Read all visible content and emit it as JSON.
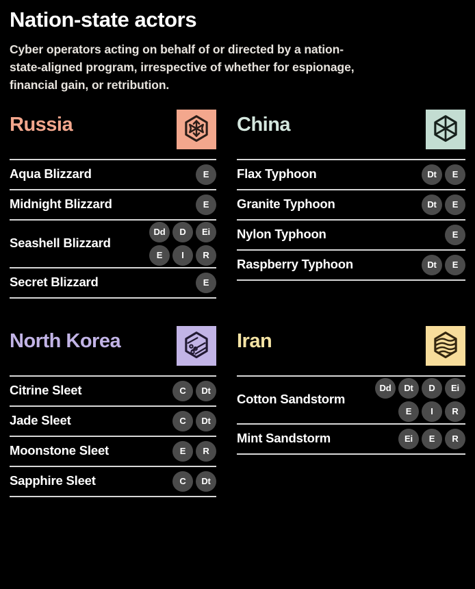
{
  "header": {
    "title": "Nation-state actors",
    "subtitle": "Cyber operators acting on behalf of or directed by a nation-state-aligned program, irrespective of whether for espionage, financial gain, or retribution."
  },
  "panels": [
    {
      "country": "Russia",
      "name_color": "#f3a78d",
      "badge_bg": "#f3a78d",
      "badge_fg": "#2b1d18",
      "icon": "blizzard-hexagon-icon",
      "actors": [
        {
          "name": "Aqua Blizzard",
          "tags": [
            "E"
          ]
        },
        {
          "name": "Midnight Blizzard",
          "tags": [
            "E"
          ]
        },
        {
          "name": "Seashell Blizzard",
          "tags": [
            "Dd",
            "D",
            "Ei",
            "E",
            "I",
            "R"
          ]
        },
        {
          "name": "Secret Blizzard",
          "tags": [
            "E"
          ]
        }
      ]
    },
    {
      "country": "China",
      "name_color": "#d4e7de",
      "badge_bg": "#c3ddd2",
      "badge_fg": "#17211c",
      "icon": "typhoon-hexagon-icon",
      "actors": [
        {
          "name": "Flax Typhoon",
          "tags": [
            "Dt",
            "E"
          ]
        },
        {
          "name": "Granite Typhoon",
          "tags": [
            "Dt",
            "E"
          ]
        },
        {
          "name": "Nylon Typhoon",
          "tags": [
            "E"
          ]
        },
        {
          "name": "Raspberry Typhoon",
          "tags": [
            "Dt",
            "E"
          ]
        }
      ]
    },
    {
      "country": "North Korea",
      "name_color": "#c2b4e6",
      "badge_bg": "#c2b4e6",
      "badge_fg": "#221a33",
      "icon": "sleet-hexagon-icon",
      "actors": [
        {
          "name": "Citrine Sleet",
          "tags": [
            "C",
            "Dt"
          ]
        },
        {
          "name": "Jade Sleet",
          "tags": [
            "C",
            "Dt"
          ]
        },
        {
          "name": "Moonstone Sleet",
          "tags": [
            "E",
            "R"
          ]
        },
        {
          "name": "Sapphire Sleet",
          "tags": [
            "C",
            "Dt"
          ]
        }
      ]
    },
    {
      "country": "Iran",
      "name_color": "#f4e3a4",
      "badge_bg": "#f7dd9b",
      "badge_fg": "#33260f",
      "icon": "sandstorm-hexagon-icon",
      "actors": [
        {
          "name": "Cotton Sandstorm",
          "tags": [
            "Dd",
            "Dt",
            "D",
            "Ei",
            "E",
            "I",
            "R"
          ]
        },
        {
          "name": "Mint Sandstorm",
          "tags": [
            "Ei",
            "E",
            "R"
          ]
        }
      ]
    }
  ],
  "colors": {
    "background": "#000000",
    "divider": "#d8d8d8",
    "tag_bg": "#4b4b4b",
    "tag_fg": "#ffffff",
    "title_fg": "#ffffff",
    "subtitle_fg": "#e8e4de"
  }
}
